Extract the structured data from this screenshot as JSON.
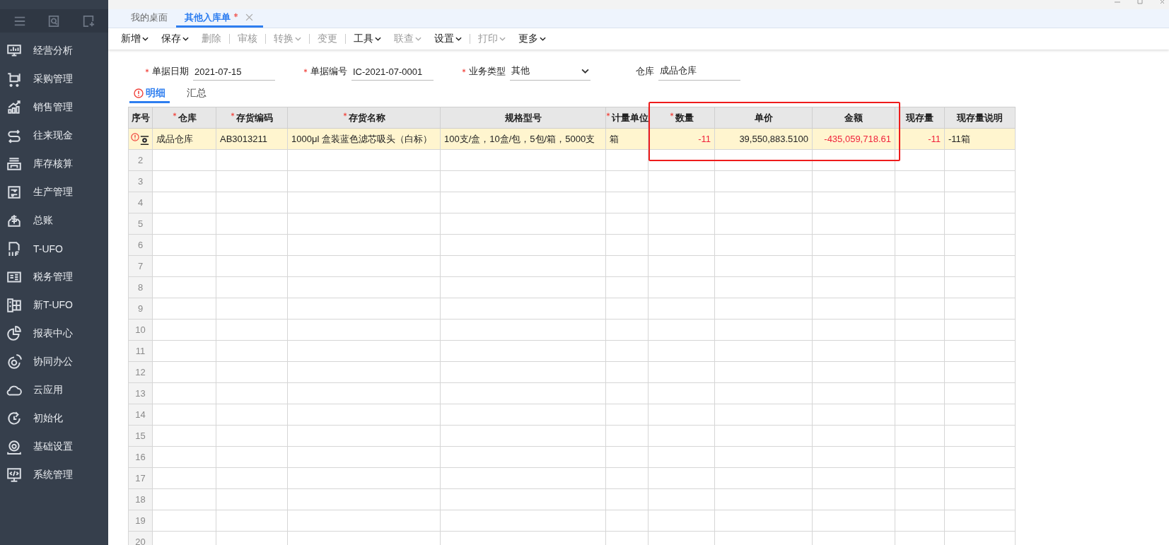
{
  "sidebar": {
    "items": [
      {
        "label": "经营分析"
      },
      {
        "label": "采购管理"
      },
      {
        "label": "销售管理"
      },
      {
        "label": "往来现金"
      },
      {
        "label": "库存核算"
      },
      {
        "label": "生产管理"
      },
      {
        "label": "总账"
      },
      {
        "label": "T-UFO"
      },
      {
        "label": "税务管理"
      },
      {
        "label": "新T-UFO"
      },
      {
        "label": "报表中心"
      },
      {
        "label": "协同办公"
      },
      {
        "label": "云应用"
      },
      {
        "label": "初始化"
      },
      {
        "label": "基础设置"
      },
      {
        "label": "系统管理"
      }
    ]
  },
  "tabs": [
    {
      "label": "我的桌面",
      "selected": false,
      "modified": false,
      "closable": false
    },
    {
      "label": "其他入库单",
      "selected": true,
      "modified": true,
      "closable": true
    }
  ],
  "toolbar": [
    {
      "label": "新增",
      "disabled": false,
      "dropdown": true,
      "divider": false
    },
    {
      "label": "保存",
      "disabled": false,
      "dropdown": true,
      "divider": false
    },
    {
      "label": "删除",
      "disabled": true,
      "dropdown": false,
      "divider": true
    },
    {
      "label": "审核",
      "disabled": true,
      "dropdown": false,
      "divider": true
    },
    {
      "label": "转换",
      "disabled": true,
      "dropdown": true,
      "divider": true
    },
    {
      "label": "变更",
      "disabled": true,
      "dropdown": false,
      "divider": true
    },
    {
      "label": "工具",
      "disabled": false,
      "dropdown": true,
      "divider": false
    },
    {
      "label": "联查",
      "disabled": true,
      "dropdown": true,
      "divider": false
    },
    {
      "label": "设置",
      "disabled": false,
      "dropdown": true,
      "divider": true
    },
    {
      "label": "打印",
      "disabled": true,
      "dropdown": true,
      "divider": false
    },
    {
      "label": "更多",
      "disabled": false,
      "dropdown": true,
      "divider": false
    }
  ],
  "form": [
    {
      "label": "单据日期",
      "value": "2021-07-15",
      "required": true,
      "dropdown": false
    },
    {
      "label": "单据编号",
      "value": "IC-2021-07-0001",
      "required": true,
      "dropdown": false
    },
    {
      "label": "业务类型",
      "value": "其他",
      "required": true,
      "dropdown": true
    },
    {
      "label": "仓库",
      "value": "成品仓库",
      "required": false,
      "dropdown": false
    }
  ],
  "subtabs": [
    {
      "label": "明细",
      "selected": true,
      "error": true
    },
    {
      "label": "汇总",
      "selected": false,
      "error": false
    }
  ],
  "table": {
    "columns": [
      {
        "label": "序号",
        "required": false
      },
      {
        "label": "仓库",
        "required": true
      },
      {
        "label": "存货编码",
        "required": true
      },
      {
        "label": "存货名称",
        "required": true
      },
      {
        "label": "规格型号",
        "required": false
      },
      {
        "label": "计量单位",
        "required": true
      },
      {
        "label": "数量",
        "required": true
      },
      {
        "label": "单价",
        "required": false
      },
      {
        "label": "金额",
        "required": false
      },
      {
        "label": "现存量",
        "required": false
      },
      {
        "label": "现存量说明",
        "required": false
      }
    ],
    "rows": [
      {
        "selected": true,
        "error": true,
        "cells": [
          {
            "text": "成品仓库",
            "negative": false
          },
          {
            "text": "AB3013211",
            "negative": false
          },
          {
            "text": "1000μl 盒装蓝色滤芯吸头（白标）",
            "negative": false
          },
          {
            "text": "100支/盒，10盒/包，5包/箱，5000支",
            "negative": false
          },
          {
            "text": "箱",
            "negative": false
          },
          {
            "text": "-11",
            "negative": true
          },
          {
            "text": "39,550,883.5100",
            "negative": false
          },
          {
            "text": "-435,059,718.61",
            "negative": true
          },
          {
            "text": "-11",
            "negative": true
          },
          {
            "text": "-11箱",
            "negative": false
          }
        ]
      },
      {
        "selected": false,
        "error": false,
        "number": "2"
      },
      {
        "selected": false,
        "error": false,
        "number": "3"
      },
      {
        "selected": false,
        "error": false,
        "number": "4"
      },
      {
        "selected": false,
        "error": false,
        "number": "5"
      },
      {
        "selected": false,
        "error": false,
        "number": "6"
      },
      {
        "selected": false,
        "error": false,
        "number": "7"
      },
      {
        "selected": false,
        "error": false,
        "number": "8"
      },
      {
        "selected": false,
        "error": false,
        "number": "9"
      },
      {
        "selected": false,
        "error": false,
        "number": "10"
      },
      {
        "selected": false,
        "error": false,
        "number": "11"
      },
      {
        "selected": false,
        "error": false,
        "number": "12"
      },
      {
        "selected": false,
        "error": false,
        "number": "13"
      },
      {
        "selected": false,
        "error": false,
        "number": "14"
      },
      {
        "selected": false,
        "error": false,
        "number": "15"
      },
      {
        "selected": false,
        "error": false,
        "number": "16"
      },
      {
        "selected": false,
        "error": false,
        "number": "17"
      },
      {
        "selected": false,
        "error": false,
        "number": "18"
      },
      {
        "selected": false,
        "error": false,
        "number": "19"
      },
      {
        "selected": false,
        "error": false,
        "number": "20"
      }
    ]
  }
}
